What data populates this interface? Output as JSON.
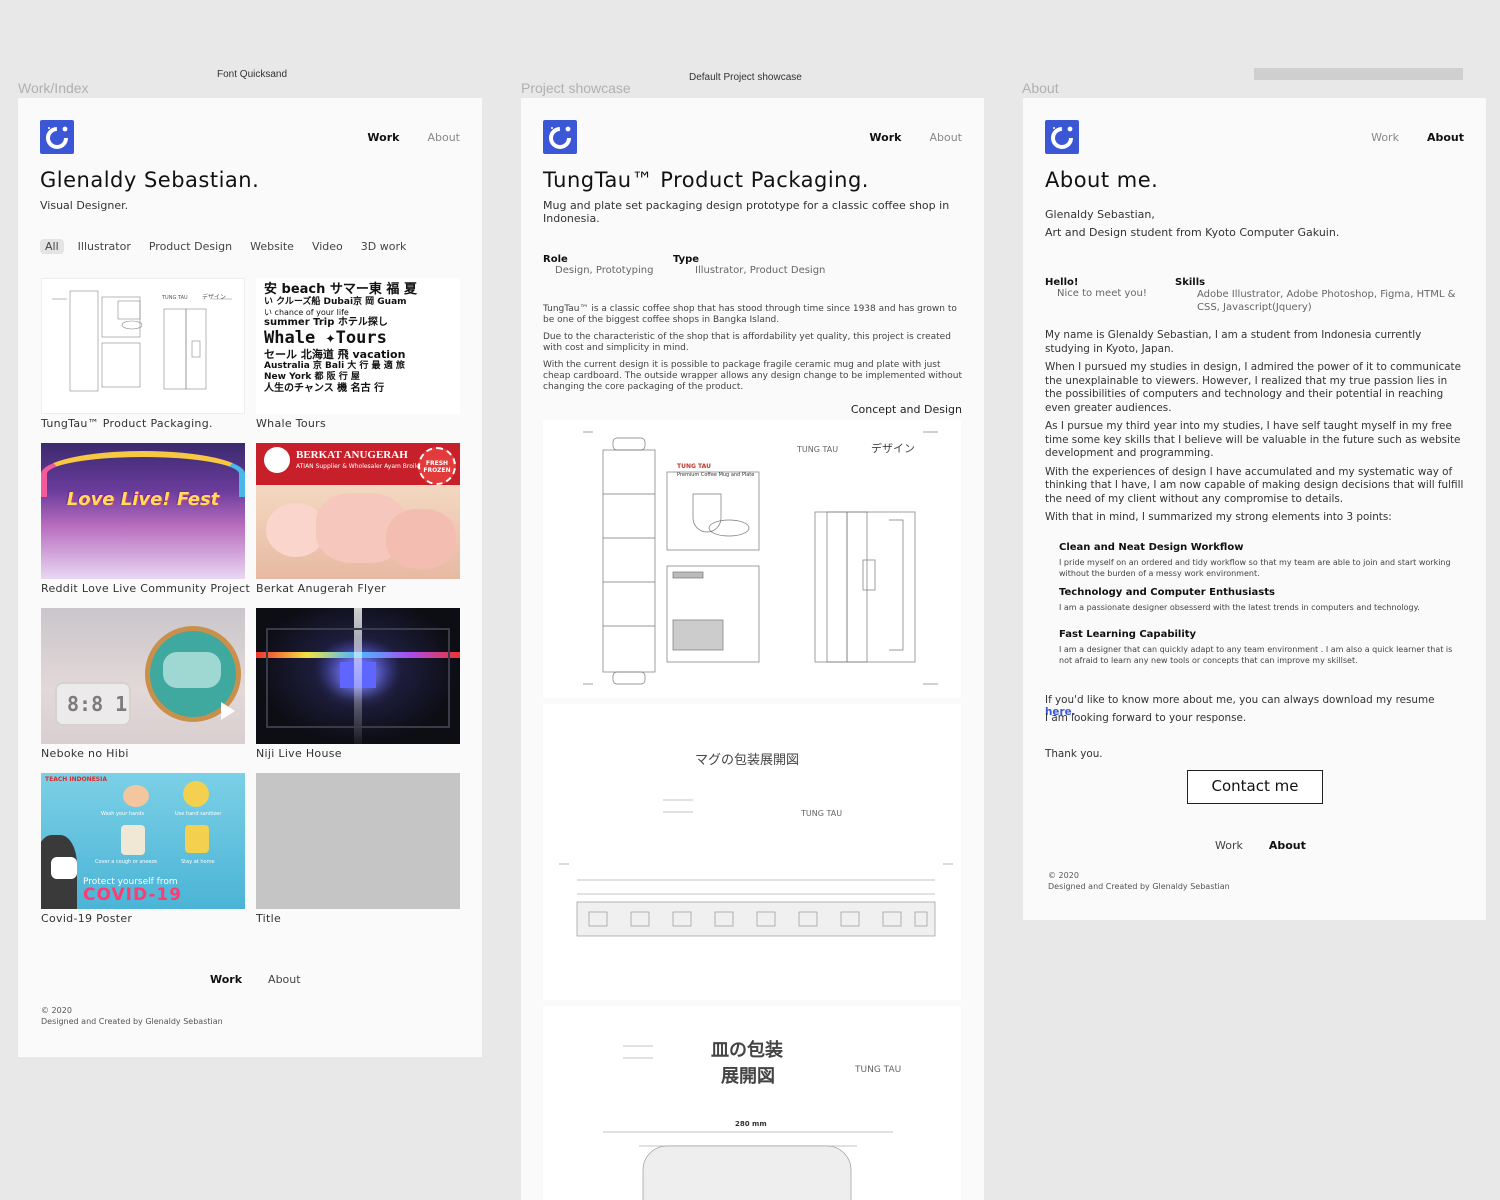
{
  "labels": {
    "frame1": "Work/Index",
    "frame2": "Project showcase",
    "frame3": "About",
    "note1": "Font Quicksand",
    "note2": "Default Project showcase"
  },
  "nav": {
    "work": "Work",
    "about": "About"
  },
  "index": {
    "title": "Glenaldy Sebastian.",
    "subtitle": "Visual Designer.",
    "filters": [
      "All",
      "Illustrator",
      "Product Design",
      "Website",
      "Video",
      "3D work"
    ],
    "items": [
      "TungTau™ Product Packaging.",
      "Whale Tours",
      "Reddit Love Live Community Project",
      "Berkat Anugerah Flyer",
      "Neboke no Hibi",
      "Niji Live House",
      "Covid-19 Poster",
      "Title"
    ],
    "whale_text": [
      "安 beach サマー東 福 夏",
      "い クルーズ船 Dubai京 岡 Guam",
      "い chance of your life",
      "summer Trip ホテル探し",
      "Whale ✦Tours",
      "セール 北海道 飛 vacation",
      "Australia 京 Bali 大 行 最 適 旅",
      "New York 都 阪 行 屋",
      "人生のチャンス 機 名古 行"
    ],
    "love_live": "Love Live! Fest",
    "berkat_name": "BERKAT ANUGERAH",
    "berkat_sub": "ATIAN  Supplier & Wholesaler Ayam Broiler",
    "berkat_badge": "FRESH FROZEN",
    "clock": "8:8 1",
    "covid_brand": "TEACH INDONESIA",
    "covid_tips": [
      "Wash your hands",
      "Use hand sanitizer",
      "Cover a cough or sneeze",
      "Stay at home"
    ],
    "covid_title": "Protect yourself from",
    "covid_big": "COVID-19"
  },
  "project": {
    "title": "TungTau™ Product Packaging.",
    "desc": "Mug and plate set packaging design prototype for a classic coffee shop in Indonesia.",
    "role_label": "Role",
    "role_value": "Design, Prototyping",
    "type_label": "Type",
    "type_value": "Illustrator, Product Design",
    "p1": "TungTau™ is a classic coffee shop that has stood through time since 1938 and has grown to be one of the biggest coffee shops in Bangka Island.",
    "p2": "Due to the characteristic of the shop that is affordability yet quality, this project is created with cost and simplicity in mind.",
    "p3": "With the current design it is possible to package fragile ceramic mug and plate with just cheap cardboard. The outside wrapper allows any design change to be implemented without changing the core packaging of the product.",
    "caption": "Concept and Design",
    "jp_mug": "マグの包装展開図",
    "jp_plate_1": "皿の包装",
    "jp_plate_2": "展開図",
    "jp_design": "デザイン",
    "brand": "TUNG TAU",
    "dim": "280 mm",
    "premium": "Premium Coffee Mug and Plate"
  },
  "about": {
    "title": "About me.",
    "intro_1": "Glenaldy Sebastian,",
    "intro_2": "Art and Design student from Kyoto Computer Gakuin.",
    "hello_label": "Hello!",
    "hello_value": "Nice to meet you!",
    "skills_label": "Skills",
    "skills_value": "Adobe Illustrator, Adobe Photoshop, Figma,  HTML & CSS, Javascript(Jquery)",
    "p1": "My name is Glenaldy Sebastian, I am a student from Indonesia currently studying in Kyoto, Japan.",
    "p2": "When I pursued my studies in design, I admired the power of it to communicate the unexplainable to viewers. However, I realized that my true passion lies in the possibilities of computers and technology and their potential in reaching even greater audiences.",
    "p3": "As I pursue my third year into my studies, I have self taught myself in my free time some key skills that I believe will be valuable in the future such as website development and programming.",
    "p4": "With the experiences of design I have accumulated and my systematic way of thinking that I have, I am now capable of making design decisions that will fulfill the need of my client without any compromise to details.",
    "p5": "With that in mind, I summarized my strong elements into 3 points:",
    "points": [
      {
        "title": "Clean and Neat Design Workflow",
        "text": "I pride myself on an ordered and tidy workflow so that my team are able to join and start working without the burden of a messy work environment."
      },
      {
        "title": "Technology and Computer Enthusiasts",
        "text": "I am a passionate designer obsesserd with the latest trends in computers and technology."
      },
      {
        "title": "Fast Learning Capability",
        "text": "I am a designer that can quickly adapt to any team environment . I am also a quick learner that is not afraid to learn any new tools or concepts that can improve my skillset."
      }
    ],
    "resume_text": "If you'd like to know more about me, you can always download my resume ",
    "resume_link": "here.",
    "looking": "I am looking forward to your response.",
    "thanks": "Thank you.",
    "contact": "Contact me"
  },
  "footer": {
    "copy": "© 2020",
    "credit": "Designed and Created by Glenaldy Sebastian"
  },
  "colors": {
    "accent": "#3b57d6",
    "link": "#3b57d6",
    "bg": "#e8e8e8",
    "frame": "#fafafa"
  }
}
